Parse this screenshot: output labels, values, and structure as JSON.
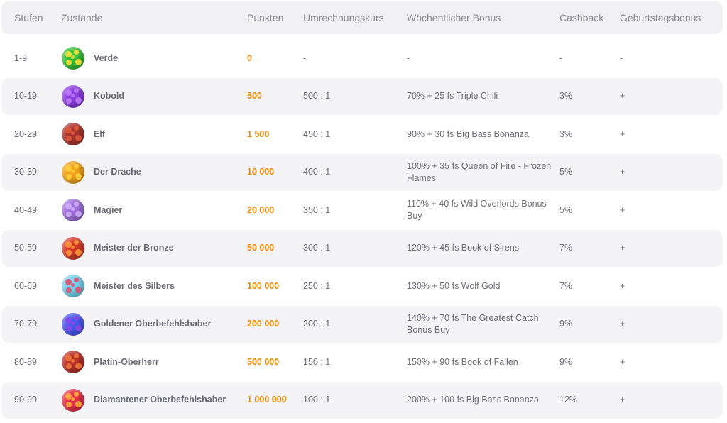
{
  "headers": {
    "level": "Stufen",
    "status": "Zustände",
    "points": "Punkten",
    "rate": "Umrechnungskurs",
    "bonus": "Wöchentlicher Bonus",
    "cashback": "Cashback",
    "birthday": "Geburtstagsbonus"
  },
  "rows": [
    {
      "level": "1-9",
      "name": "Verde",
      "points": "0",
      "rate": "-",
      "bonus": "-",
      "cashback": "-",
      "birthday": "-",
      "icon": "green-planet-icon",
      "color": "#37c23a",
      "spot": "#ffe23a"
    },
    {
      "level": "10-19",
      "name": "Kobold",
      "points": "500",
      "rate": "500 : 1",
      "bonus": "70% + 25 fs Triple Chili",
      "cashback": "3%",
      "birthday": "+",
      "icon": "purple-planet-icon",
      "color": "#8a3ee0",
      "spot": "#c07af5"
    },
    {
      "level": "20-29",
      "name": "Elf",
      "points": "1 500",
      "rate": "450 : 1",
      "bonus": "90% + 30 fs Big Bass Bonanza",
      "cashback": "3%",
      "birthday": "+",
      "icon": "red-rock-planet-icon",
      "color": "#a8342e",
      "spot": "#e05a3c"
    },
    {
      "level": "30-39",
      "name": "Der Drache",
      "points": "10 000",
      "rate": "400 : 1",
      "bonus": "100% + 35 fs Queen of Fire - Frozen Flames",
      "cashback": "5%",
      "birthday": "+",
      "icon": "orange-planet-icon",
      "color": "#f5a31a",
      "spot": "#ffd23c"
    },
    {
      "level": "40-49",
      "name": "Magier",
      "points": "20 000",
      "rate": "350 : 1",
      "bonus": "110% + 40 fs Wild Overlords Bonus Buy",
      "cashback": "5%",
      "birthday": "+",
      "icon": "lilac-planet-icon",
      "color": "#a070e0",
      "spot": "#d2b0f7"
    },
    {
      "level": "50-59",
      "name": "Meister der Bronze",
      "points": "50 000",
      "rate": "300 : 1",
      "bonus": "120% + 45 fs Book of Sirens",
      "cashback": "7%",
      "birthday": "+",
      "icon": "red-orange-planet-icon",
      "color": "#d83a2a",
      "spot": "#ff9a3a"
    },
    {
      "level": "60-69",
      "name": "Meister des Silbers",
      "points": "100 000",
      "rate": "250 : 1",
      "bonus": "130% + 50 fs Wolf Gold",
      "cashback": "7%",
      "birthday": "+",
      "icon": "light-blue-planet-icon",
      "color": "#7ad4f0",
      "spot": "#e04a6a"
    },
    {
      "level": "70-79",
      "name": "Goldener Oberbefehlshaber",
      "points": "200 000",
      "rate": "200 : 1",
      "bonus": "140% + 70 fs The Greatest Catch Bonus Buy",
      "cashback": "9%",
      "birthday": "+",
      "icon": "blue-planet-icon",
      "color": "#4a5af0",
      "spot": "#8a4ae6"
    },
    {
      "level": "80-89",
      "name": "Platin-Oberherr",
      "points": "500 000",
      "rate": "150 : 1",
      "bonus": "150% + 90 fs Book of Fallen",
      "cashback": "9%",
      "birthday": "+",
      "icon": "magma-planet-icon",
      "color": "#b8302a",
      "spot": "#f07a3a"
    },
    {
      "level": "90-99",
      "name": "Diamantener Oberbefehlshaber",
      "points": "1 000 000",
      "rate": "100 : 1",
      "bonus": "200% + 100 fs Big Bass Bonanza",
      "cashback": "12%",
      "birthday": "+",
      "icon": "pink-red-planet-icon",
      "color": "#e8304a",
      "spot": "#ffb03a"
    }
  ]
}
